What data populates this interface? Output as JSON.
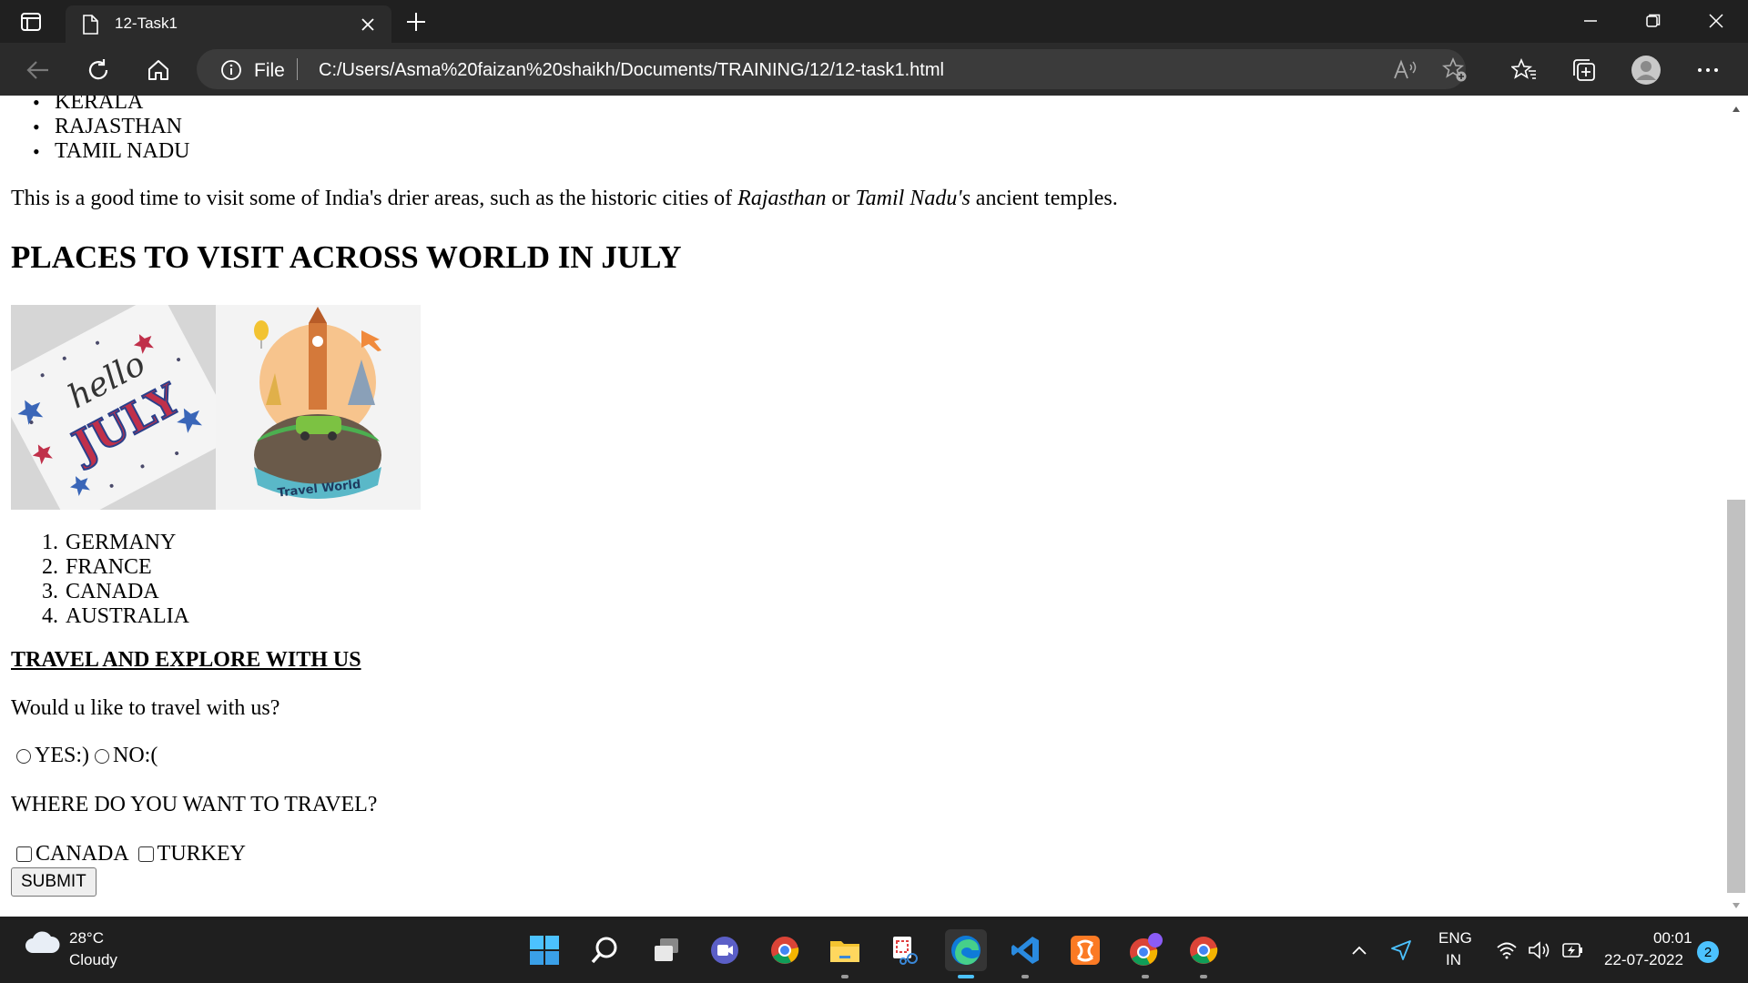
{
  "browser": {
    "tab_title": "12-Task1",
    "address_scheme": "File",
    "address_url": "C:/Users/Asma%20faizan%20shaikh/Documents/TRAINING/12/12-task1.html"
  },
  "page": {
    "states_list": [
      "KERALA",
      "RAJASTHAN",
      "TAMIL NADU"
    ],
    "paragraph": {
      "part1": "This is a good time to visit some of India's drier areas, such as the historic cities of ",
      "em1": "Rajasthan",
      "part2": " or ",
      "em2": "Tamil Nadu's",
      "part3": " ancient temples."
    },
    "heading": "PLACES TO VISIT ACROSS WORLD IN JULY",
    "image1": {
      "script_text": "hello",
      "banner_text": "JULY"
    },
    "image2": {
      "caption": "Travel World"
    },
    "countries": [
      {
        "num": "1.",
        "name": "GERMANY"
      },
      {
        "num": "2.",
        "name": "FRANCE"
      },
      {
        "num": "3.",
        "name": "CANADA"
      },
      {
        "num": "4.",
        "name": "AUSTRALIA"
      }
    ],
    "travel_title": "TRAVEL AND EXPLORE WITH US",
    "question": "Would u like to travel with us?",
    "radio_yes": "YES:)",
    "radio_no": "NO:(",
    "travel_question": "WHERE DO YOU WANT TO TRAVEL?",
    "checkbox_canada": "CANADA",
    "checkbox_turkey": "TURKEY",
    "submit_label": "SUBMIT"
  },
  "taskbar": {
    "temperature": "28°C",
    "weather": "Cloudy",
    "lang_top": "ENG",
    "lang_bottom": "IN",
    "time": "00:01",
    "date": "22-07-2022",
    "notifications": "2"
  }
}
